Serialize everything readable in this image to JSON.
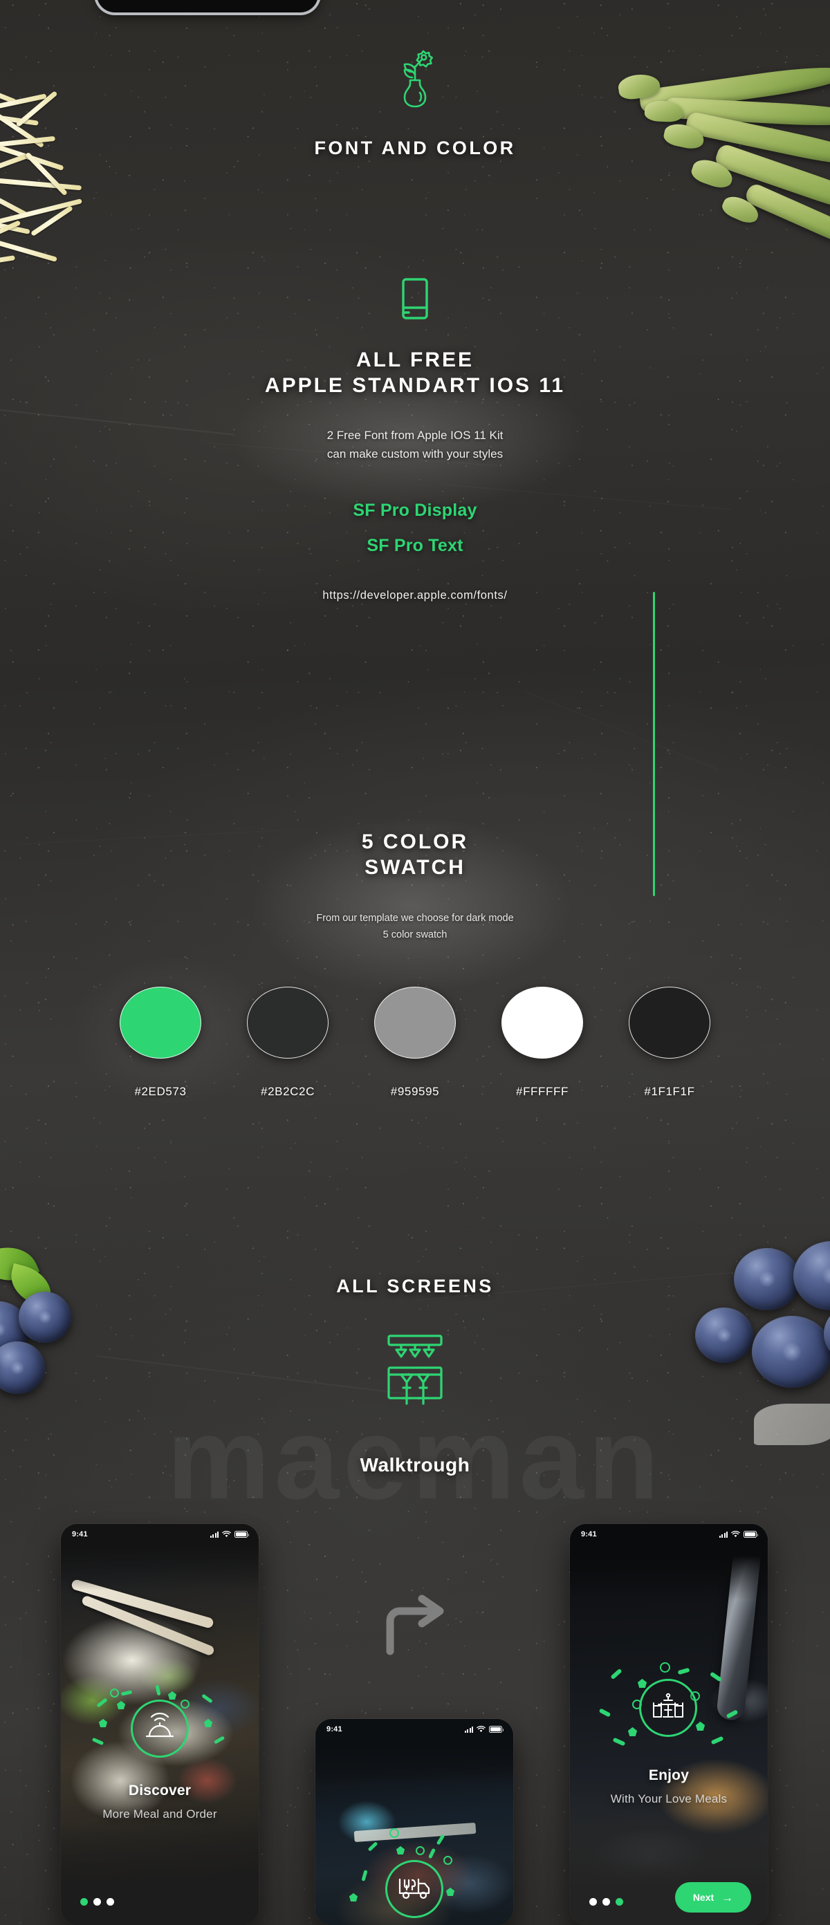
{
  "background": {
    "watermark_text": "maeman"
  },
  "accent_color": "#2ED573",
  "sections": {
    "font_and_color": {
      "icon": "flower-vase-icon",
      "title": "FONT AND COLOR"
    },
    "all_free": {
      "icon": "book-icon",
      "title_line1": "ALL FREE",
      "title_line2": "APPLE STANDART IOS 11",
      "sub_line1": "2 Free Font from Apple IOS 11 Kit",
      "sub_line2": "can make custom with your styles",
      "font_primary": "SF Pro Display",
      "font_secondary": "SF Pro Text",
      "url": "https://developer.apple.com/fonts/"
    },
    "color_swatch": {
      "title_line1": "5 COLOR",
      "title_line2": "SWATCH",
      "sub_line1": "From our template we choose for dark mode",
      "sub_line2": "5 color swatch",
      "swatches": [
        {
          "hex": "#2ED573",
          "label": "#2ED573",
          "name": "swatch-green"
        },
        {
          "hex": "#2B2C2C",
          "label": "#2B2C2C",
          "name": "swatch-dark-gray"
        },
        {
          "hex": "#959595",
          "label": "#959595",
          "name": "swatch-mid-gray"
        },
        {
          "hex": "#FFFFFF",
          "label": "#FFFFFF",
          "name": "swatch-white"
        },
        {
          "hex": "#1F1F1F",
          "label": "#1F1F1F",
          "name": "swatch-near-black"
        }
      ]
    },
    "all_screens": {
      "title": "ALL SCREENS",
      "icon": "bar-counter-icon",
      "subtitle": "Walktrough"
    }
  },
  "phones": [
    {
      "id": "phone-discover",
      "status_time": "9:41",
      "icon": "food-cloche-wifi-icon",
      "title": "Discover",
      "subtitle": "More Meal and Order",
      "dots": [
        true,
        false,
        false
      ],
      "next_label": null
    },
    {
      "id": "phone-delivery",
      "status_time": "9:41",
      "icon": "food-truck-icon",
      "title": "",
      "subtitle": "",
      "dots": [
        false,
        true,
        false
      ],
      "next_label": null
    },
    {
      "id": "phone-enjoy",
      "status_time": "9:41",
      "icon": "dining-table-icon",
      "title": "Enjoy",
      "subtitle": "With Your Love Meals",
      "dots": [
        false,
        false,
        true
      ],
      "next_label": "Next",
      "next_arrow": "→"
    }
  ]
}
